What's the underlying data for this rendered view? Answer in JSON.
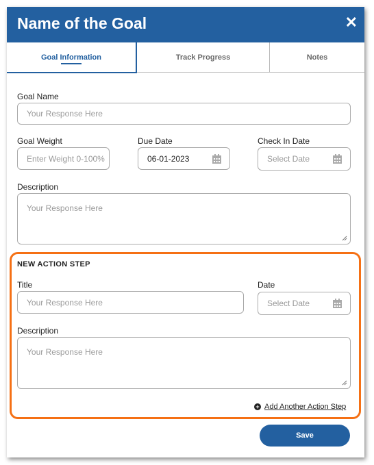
{
  "header": {
    "title": "Name of the Goal",
    "close_icon": "close-icon"
  },
  "tabs": [
    {
      "label": "Goal Information",
      "active": true
    },
    {
      "label": "Track Progress"
    },
    {
      "label": "Notes"
    }
  ],
  "form": {
    "goal_name": {
      "label": "Goal Name",
      "placeholder": "Your Response Here"
    },
    "goal_weight": {
      "label": "Goal Weight",
      "placeholder": "Enter Weight 0-100%"
    },
    "due_date": {
      "label": "Due Date",
      "value": "06-01-2023"
    },
    "check_in_date": {
      "label": "Check In Date",
      "placeholder": "Select Date"
    },
    "description": {
      "label": "Description",
      "placeholder": "Your Response Here"
    }
  },
  "action_step": {
    "heading": "NEW ACTION STEP",
    "title": {
      "label": "Title",
      "placeholder": "Your Response Here"
    },
    "date": {
      "label": "Date",
      "placeholder": "Select Date"
    },
    "description": {
      "label": "Description",
      "placeholder": "Your Response Here"
    },
    "add_link": "Add Another Action Step"
  },
  "save_label": "Save",
  "colors": {
    "primary": "#2360a0",
    "highlight": "#f57014"
  }
}
